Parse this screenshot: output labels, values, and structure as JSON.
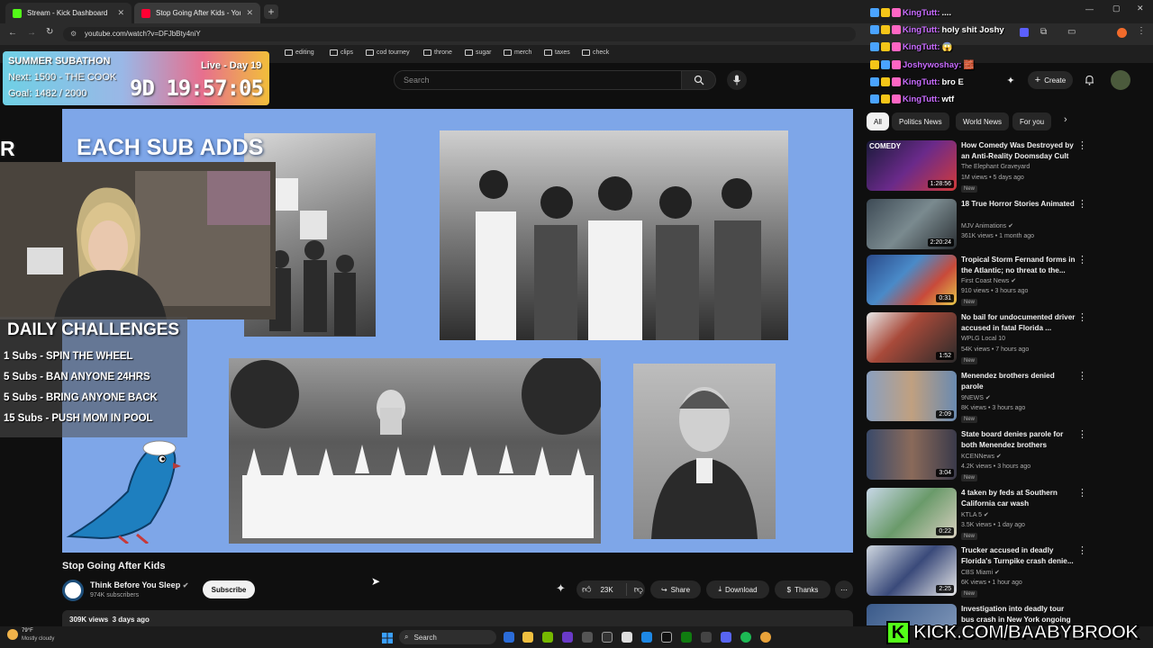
{
  "browser": {
    "tabs": [
      {
        "label": "Stream - Kick Dashboard",
        "active": false
      },
      {
        "label": "Stop Going After Kids - You",
        "active": true
      }
    ],
    "url": "youtube.com/watch?v=DFJbBty4niY",
    "bookmarks": [
      "editing",
      "clips",
      "cod tourney",
      "throne",
      "sugar",
      "merch",
      "taxes",
      "check"
    ]
  },
  "youtube": {
    "search_placeholder": "Search",
    "create_label": "Create",
    "chips": [
      "All",
      "Politics News",
      "World News",
      "For you"
    ],
    "video": {
      "title": "Stop Going After Kids",
      "channel": "Think Before You Sleep",
      "subscribers": "974K subscribers",
      "subscribe_label": "Subscribe",
      "likes": "23K",
      "share_label": "Share",
      "download_label": "Download",
      "thanks_label": "Thanks",
      "views_line": "309K views  3 days ago"
    },
    "recommended": [
      {
        "title": "How Comedy Was Destroyed by an Anti-Reality Doomsday Cult",
        "channel": "The Elephant Graveyard",
        "meta": "1M views • 5 days ago",
        "duration": "1:28:56",
        "new": "New",
        "verified": false
      },
      {
        "title": "18 True Horror Stories Animated",
        "channel": "MJV Animations",
        "meta": "361K views • 1 month ago",
        "duration": "2:20:24",
        "new": "",
        "verified": true
      },
      {
        "title": "Tropical Storm Fernand forms in the Atlantic; no threat to the...",
        "channel": "First Coast News",
        "meta": "910 views • 3 hours ago",
        "duration": "0:31",
        "new": "New",
        "verified": true
      },
      {
        "title": "No bail for undocumented driver accused in fatal Florida ...",
        "channel": "WPLG Local 10",
        "meta": "54K views • 7 hours ago",
        "duration": "1:52",
        "new": "New",
        "verified": false
      },
      {
        "title": "Menendez brothers denied parole",
        "channel": "9NEWS",
        "meta": "8K views • 3 hours ago",
        "duration": "2:09",
        "new": "New",
        "verified": true
      },
      {
        "title": "State board denies parole for both Menendez brothers",
        "channel": "KCENNews",
        "meta": "4.2K views • 3 hours ago",
        "duration": "3:04",
        "new": "New",
        "verified": true
      },
      {
        "title": "4 taken by feds at Southern California car wash",
        "channel": "KTLA 5",
        "meta": "3.5K views • 1 day ago",
        "duration": "0:22",
        "new": "New",
        "verified": true
      },
      {
        "title": "Trucker accused in deadly Florida's Turnpike crash denie...",
        "channel": "CBS Miami",
        "meta": "6K views • 1 hour ago",
        "duration": "2:25",
        "new": "New",
        "verified": true
      },
      {
        "title": "Investigation into deadly tour bus crash in New York ongoing",
        "channel": "",
        "meta": "",
        "duration": "",
        "new": "",
        "verified": false
      }
    ]
  },
  "overlay": {
    "subathon_title": "SUMMER SUBATHON",
    "live_day": "Live - Day 19",
    "next": "Next: 1500 - THE COOK",
    "goal": "Goal: 1482 / 2000",
    "timer": "9D 19:57:05",
    "each_sub": "EACH SUB ADDS",
    "r_letter": "R",
    "challenges_title": "DAILY CHALLENGES",
    "challenges": [
      "1 Subs - SPIN THE WHEEL",
      "5 Subs - BAN ANYONE 24HRS",
      "5 Subs - BRING ANYONE BACK",
      "15 Subs - PUSH MOM IN POOL"
    ],
    "chat": [
      {
        "user": "KingTutt:",
        "msg": "....",
        "color": "#c86bff"
      },
      {
        "user": "KingTutt:",
        "msg": "holy shit Joshy",
        "color": "#c86bff"
      },
      {
        "user": "KingTutt:",
        "msg": "😱",
        "color": "#c86bff"
      },
      {
        "user": "Joshywoshay:",
        "msg": "🧱",
        "color": "#c86bff"
      },
      {
        "user": "KingTutt:",
        "msg": "bro E",
        "color": "#c86bff"
      },
      {
        "user": "KingTutt:",
        "msg": "wtf",
        "color": "#c86bff"
      }
    ],
    "kick_banner": "KICK.COM/BAABYBROOK",
    "accent_green": "#53fc18"
  },
  "taskbar": {
    "weather_temp": "79°F",
    "weather_desc": "Mostly cloudy",
    "search_label": "Search"
  }
}
